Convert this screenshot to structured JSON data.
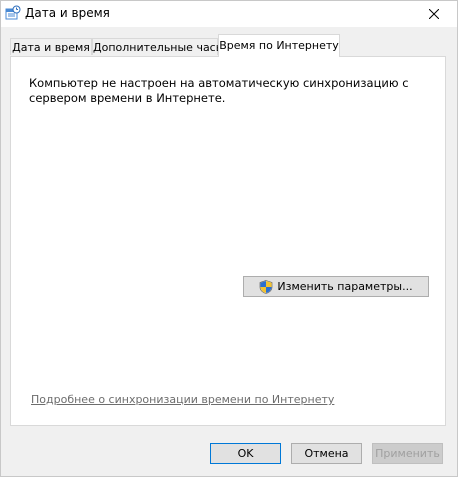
{
  "window": {
    "title": "Дата и время",
    "icon": "clock-calendar-icon"
  },
  "tabs": [
    {
      "label": "Дата и время",
      "active": false
    },
    {
      "label": "Дополнительные часы",
      "active": false
    },
    {
      "label": "Время по Интернету",
      "active": true
    }
  ],
  "panel": {
    "message": "Компьютер не настроен на автоматическую синхронизацию с сервером времени в Интернете.",
    "change_button": "Изменить параметры...",
    "help_link": "Подробнее о синхронизации времени по Интернету"
  },
  "footer": {
    "ok": "OK",
    "cancel": "Отмена",
    "apply": "Применить"
  }
}
